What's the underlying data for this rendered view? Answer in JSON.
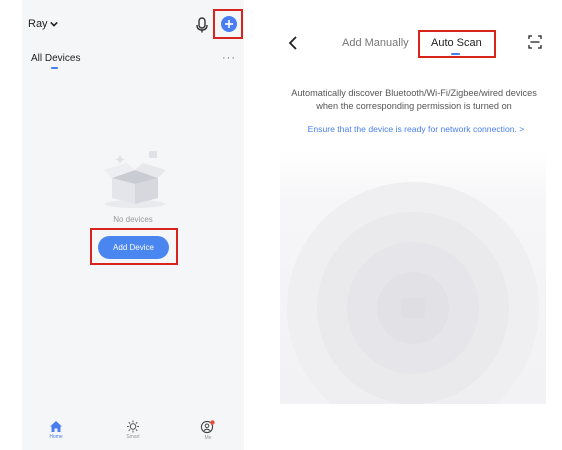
{
  "left_screen": {
    "header": {
      "home_name": "Ray"
    },
    "tabs": {
      "all_devices": "All Devices",
      "more": "···"
    },
    "empty_state": {
      "message": "No devices",
      "add_button": "Add Device"
    },
    "bottom_nav": [
      {
        "label": "Home",
        "icon": "home-icon",
        "active": true
      },
      {
        "label": "Smart",
        "icon": "sun-icon",
        "active": false
      },
      {
        "label": "Me",
        "icon": "profile-icon",
        "active": false
      }
    ]
  },
  "right_screen": {
    "tabs": {
      "add_manually": "Add Manually",
      "auto_scan": "Auto Scan"
    },
    "description": "Automatically discover Bluetooth/Wi-Fi/Zigbee/wired devices when the corresponding permission is turned on",
    "ensure_link": "Ensure that the device is ready for network connection. >"
  },
  "colors": {
    "accent": "#4a7ef0",
    "highlight": "#d9231d",
    "notification": "#e8503a"
  }
}
